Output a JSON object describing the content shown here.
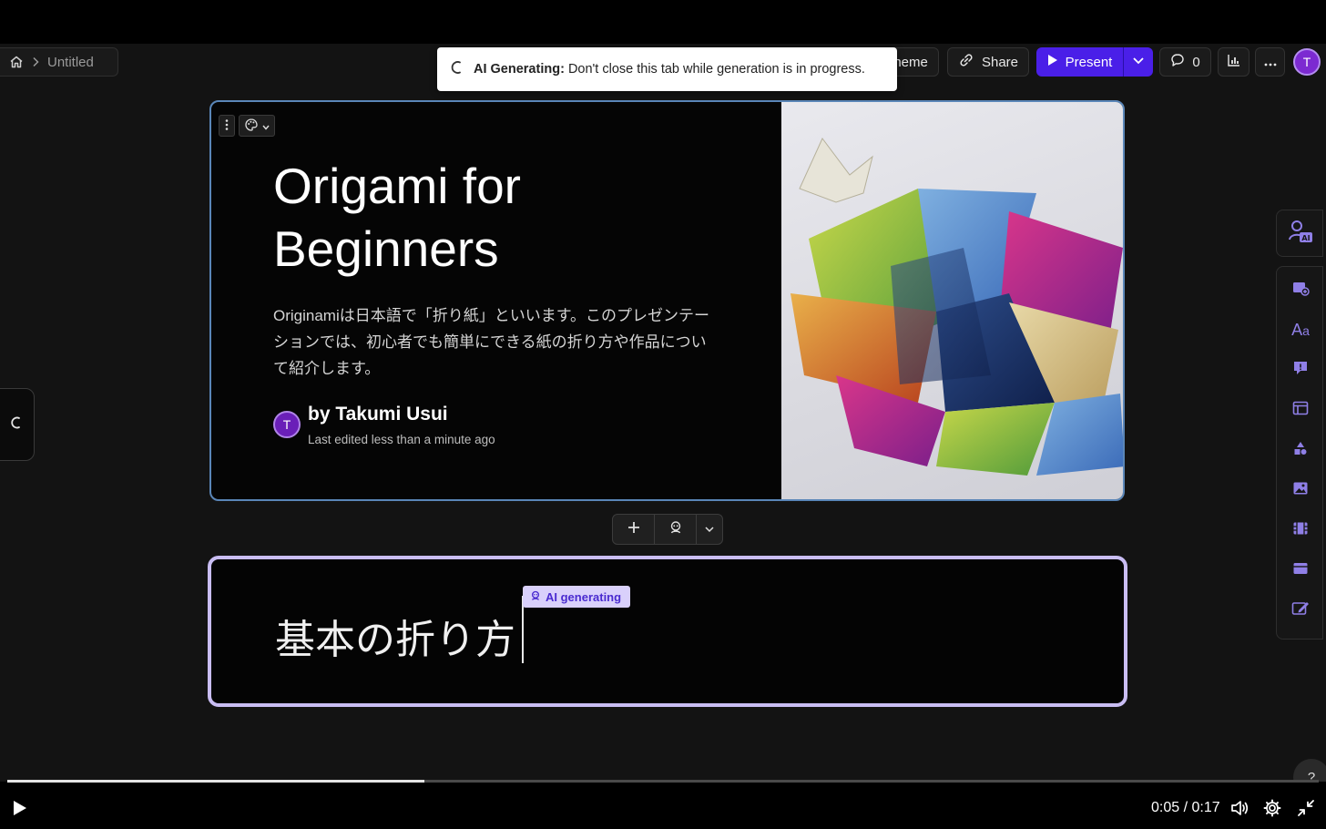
{
  "breadcrumb": {
    "home_icon": "home-icon",
    "page": "Untitled"
  },
  "toolbar": {
    "theme_label": "Theme",
    "share_label": "Share",
    "present_label": "Present",
    "comments_count": "0",
    "avatar_initial": "T"
  },
  "toast": {
    "bold": "AI Generating:",
    "message": "Don't close this tab while generation is in progress."
  },
  "card1": {
    "title_line1": "Origami for",
    "title_line2": "Beginners",
    "description": "Originamiは日本語で「折り紙」といいます。このプレゼンテーションでは、初心者でも簡単にできる紙の折り方や作品について紹介します。",
    "author_initial": "T",
    "author": "by Takumi Usui",
    "edited": "Last edited less than a minute ago"
  },
  "card2": {
    "title": "基本の折り方",
    "badge": "AI generating"
  },
  "rail": {
    "items": [
      "ai-assistant-icon",
      "add-card-icon",
      "text-icon",
      "callout-icon",
      "layout-icon",
      "shapes-icon",
      "image-icon",
      "video-icon",
      "embed-icon",
      "edit-icon"
    ]
  },
  "video": {
    "time": "0:05 / 0:17",
    "progress": 0.318
  },
  "colors": {
    "accent": "#4a1fe8",
    "card_border_active": "#c9bdf3",
    "card_border_selected": "#5a86b8",
    "badge_bg": "#d9d0fb"
  }
}
